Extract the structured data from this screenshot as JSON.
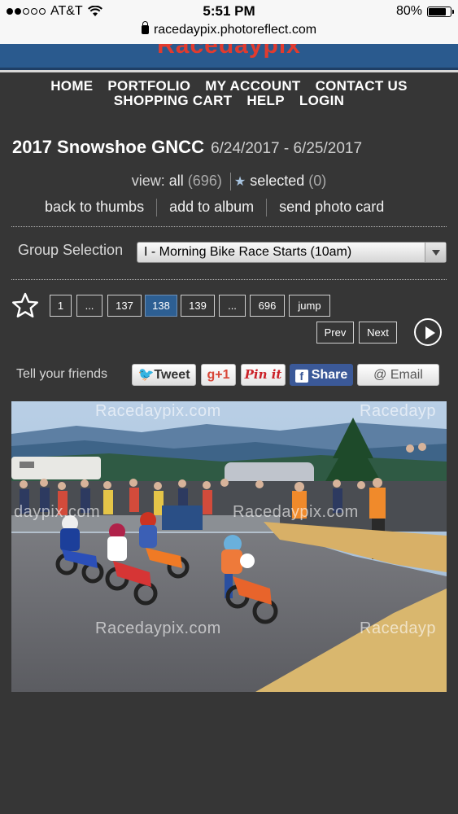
{
  "status_bar": {
    "carrier": "AT&T",
    "time": "5:51 PM",
    "battery": "80%",
    "battery_level": 0.8
  },
  "browser": {
    "url": "racedaypix.photoreflect.com"
  },
  "site": {
    "logo_text": "Racedaypix"
  },
  "nav": {
    "home": "HOME",
    "portfolio": "PORTFOLIO",
    "my_account": "MY ACCOUNT",
    "contact": "CONTACT US",
    "cart": "SHOPPING CART",
    "help": "HELP",
    "login": "LOGIN"
  },
  "event": {
    "title": "2017 Snowshoe GNCC",
    "dates": "6/24/2017 - 6/25/2017"
  },
  "view": {
    "label": "view:",
    "all_label": "all",
    "all_count": "(696)",
    "selected_label": "selected",
    "selected_count": "(0)"
  },
  "actions": {
    "back": "back to thumbs",
    "album": "add to album",
    "card": "send photo card"
  },
  "group": {
    "label": "Group Selection",
    "selected": "I - Morning Bike Race Starts (10am)"
  },
  "pagination": {
    "pages": [
      "1",
      "...",
      "137",
      "138",
      "139",
      "...",
      "696",
      "jump"
    ],
    "current": "138",
    "prev": "Prev",
    "next": "Next"
  },
  "share": {
    "label": "Tell your friends",
    "tweet": "Tweet",
    "gplus": "g+1",
    "pin": "Pin it",
    "facebook": "Share",
    "email": "@ Email"
  },
  "photo": {
    "watermark": "Racedaypix.com",
    "watermark_cut": "Racedayp",
    "watermark_left": "daypix.com"
  }
}
